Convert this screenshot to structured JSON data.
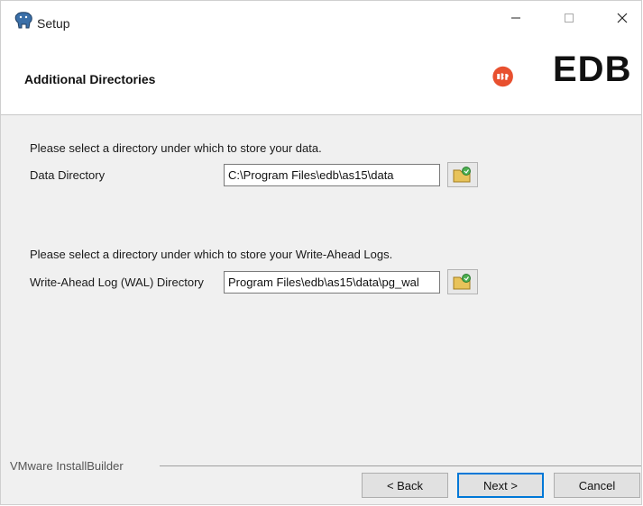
{
  "window": {
    "title": "Setup",
    "controls": {
      "minimize": "—",
      "maximize": "☐",
      "close": "✕"
    }
  },
  "header": {
    "title": "Additional Directories",
    "logo_text": "EDB",
    "logo_color": "#e8502f"
  },
  "data_section": {
    "prompt": "Please select a directory under which to store your data.",
    "field_label": "Data Directory",
    "value": "C:\\Program Files\\edb\\as15\\data"
  },
  "wal_section": {
    "prompt": "Please select a directory under which to store your Write-Ahead Logs.",
    "field_label": "Write-Ahead Log (WAL) Directory",
    "value": "Program Files\\edb\\as15\\data\\pg_wal"
  },
  "footer": {
    "brand": "VMware InstallBuilder",
    "back_label": "< Back",
    "next_label": "Next >",
    "cancel_label": "Cancel"
  },
  "icons": {
    "app": "elephant-icon",
    "browse": "folder-browse-icon"
  }
}
